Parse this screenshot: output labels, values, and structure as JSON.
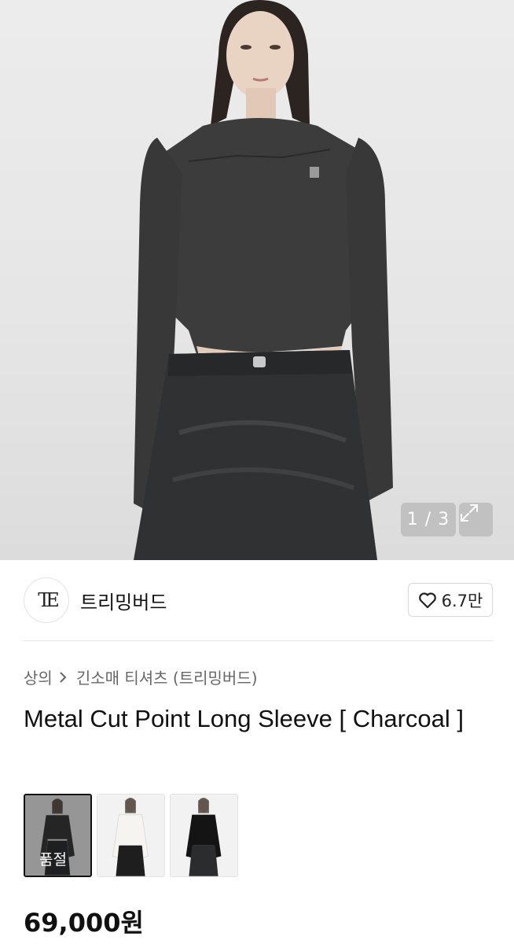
{
  "gallery": {
    "counter": "1 / 3",
    "icons": {
      "expand": "expand-arrows-icon"
    }
  },
  "brand": {
    "logo_text": "TE",
    "name": "트리밍버드",
    "likes": "6.7만",
    "icons": {
      "like": "heart-outline-icon"
    }
  },
  "breadcrumb": {
    "items": [
      "상의",
      "긴소매 티셔츠 (트리밍버드)"
    ],
    "separator_icon": "chevron-right-icon"
  },
  "product": {
    "title": "Metal Cut Point Long Sleeve [ Charcoal ]",
    "price": "69,000원"
  },
  "variants": [
    {
      "color": "charcoal",
      "label": "품절",
      "selected": true,
      "shirt_color": "#3a3a3a"
    },
    {
      "color": "white",
      "label": "",
      "selected": false,
      "shirt_color": "#f4f2ee"
    },
    {
      "color": "black",
      "label": "",
      "selected": false,
      "shirt_color": "#141414"
    }
  ],
  "colors": {
    "hero_bg": "#e8e8e8",
    "text": "#111111",
    "muted": "#666666",
    "border": "#d8d8d8"
  }
}
